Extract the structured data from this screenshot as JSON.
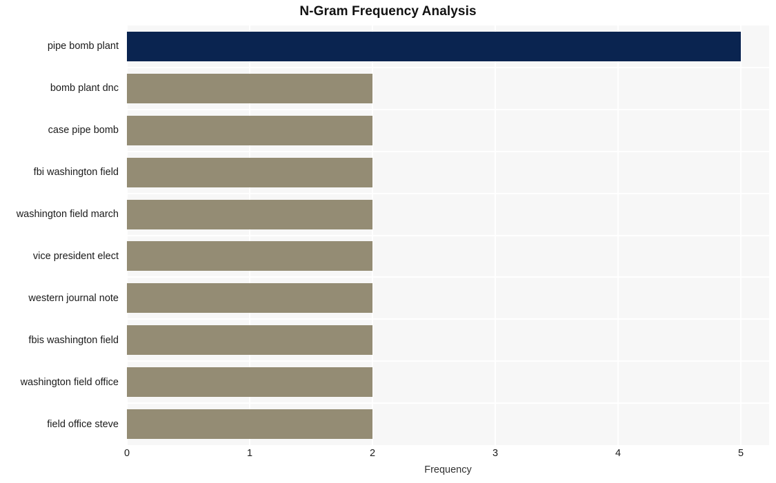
{
  "chart_data": {
    "type": "bar",
    "orientation": "horizontal",
    "title": "N-Gram Frequency Analysis",
    "xlabel": "Frequency",
    "ylabel": "",
    "categories": [
      "pipe bomb plant",
      "bomb plant dnc",
      "case pipe bomb",
      "fbi washington field",
      "washington field march",
      "vice president elect",
      "western journal note",
      "fbis washington field",
      "washington field office",
      "field office steve"
    ],
    "values": [
      5,
      2,
      2,
      2,
      2,
      2,
      2,
      2,
      2,
      2
    ],
    "xticks": [
      "0",
      "1",
      "2",
      "3",
      "4",
      "5"
    ],
    "xtick_values": [
      0,
      1,
      2,
      3,
      4,
      5
    ],
    "xlim": [
      0,
      5.23
    ],
    "grid": true,
    "legend": false,
    "bar_colors": {
      "default": "#948c74",
      "highlight": "#0a2450"
    },
    "highlight_index": 0,
    "plot_background": "#f7f7f7",
    "gridline_color": "#ffffff",
    "figure_background": "#ffffff"
  }
}
